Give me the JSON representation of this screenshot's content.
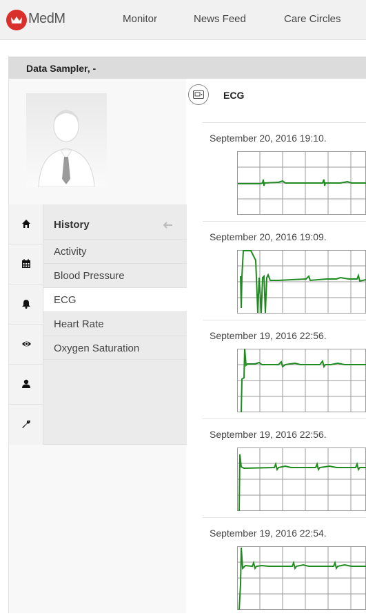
{
  "app": {
    "brand": "MedM"
  },
  "nav": {
    "items": [
      "Monitor",
      "News Feed",
      "Care Circles"
    ]
  },
  "panel": {
    "title": "Data Sampler, -"
  },
  "sidebar": {
    "icons": [
      "home-icon",
      "calendar-icon",
      "bell-icon",
      "eye-icon",
      "user-icon",
      "wrench-icon"
    ],
    "menu_title": "History",
    "items": [
      "Activity",
      "Blood Pressure",
      "ECG",
      "Heart Rate",
      "Oxygen Saturation"
    ],
    "active": "ECG"
  },
  "section": {
    "title": "ECG"
  },
  "records": [
    {
      "datetime": "September 20, 2016 19:10."
    },
    {
      "datetime": "September 20, 2016 19:09."
    },
    {
      "datetime": "September 19, 2016 22:56."
    },
    {
      "datetime": "September 19, 2016 22:56."
    },
    {
      "datetime": "September 19, 2016 22:54."
    }
  ],
  "colors": {
    "brand": "#d9302b",
    "ecg_trace": "#1f8a1f",
    "grid": "#9a9a9a"
  }
}
